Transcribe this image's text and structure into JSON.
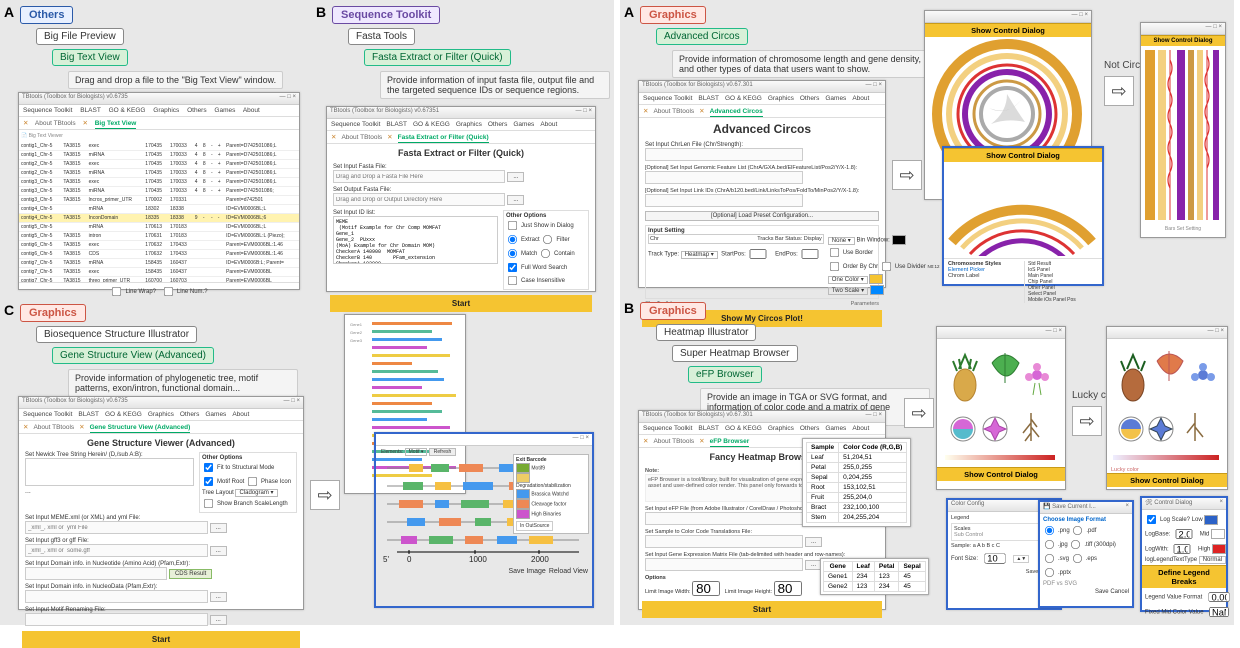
{
  "left": {
    "A": {
      "label": "A",
      "cat": "Others",
      "item1": "Big File Preview",
      "item2": "Big Text View",
      "help": "Drag and drop a file to the \"Big Text View\" window.",
      "win_title": "TBtools (Toolbox for Biologists) v0.6735",
      "menus": [
        "Sequence Toolkit",
        "BLAST",
        "GO & KEGG",
        "Graphics",
        "Others",
        "Games",
        "About"
      ],
      "tab1": "About TBtools",
      "tab2": "Big Text View",
      "rows": [
        [
          "contig1_Chr-5",
          "TA3815",
          "exec",
          "170435",
          "170033",
          "4",
          "8",
          "-",
          "+",
          "Parent=D742501086;L"
        ],
        [
          "contig1_Chr-5",
          "TA3815",
          "miRNA",
          "170435",
          "170033",
          "4",
          "8",
          "-",
          "+",
          "Parent=D742501086;L"
        ],
        [
          "contig2_Chr-5",
          "TA3815",
          "exec",
          "170435",
          "170033",
          "4",
          "8",
          "-",
          "+",
          "Parent=D742501086;L"
        ],
        [
          "contig2_Chr-5",
          "TA3815",
          "miRNA",
          "170435",
          "170033",
          "4",
          "8",
          "-",
          "+",
          "Parent=D742501086;L"
        ],
        [
          "contig3_Chr-5",
          "TA3815",
          "exec",
          "170435",
          "170033",
          "4",
          "8",
          "-",
          "+",
          "Parent=D742501086;L"
        ],
        [
          "contig3_Chr-5",
          "TA3815",
          "miRNA",
          "170435",
          "170033",
          "4",
          "8",
          "-",
          "+",
          "Parent=D742501086;"
        ],
        [
          "contig3_Chr-5",
          "TA3815",
          "lncros_primer_UTR",
          "170002",
          "170331",
          "",
          "",
          "",
          "",
          "Parent=d742501"
        ],
        [
          "contig4_Chr-5",
          "",
          "mRNA",
          "18302",
          "18338",
          "",
          "",
          "",
          "",
          "ID=EVM0006BL;L"
        ],
        [
          "contig4_Chr-5",
          "TA3815",
          "InconDomain",
          "18335",
          "18338",
          "9",
          "-",
          "-",
          "-",
          "ID=EVM0006BL;6"
        ],
        [
          "contig5_Chr-5",
          "",
          "mRNA",
          "170613",
          "170183",
          "",
          "",
          "",
          "",
          "ID=EVM0006BL;L"
        ],
        [
          "contig5_Chr-5",
          "TA3815",
          "intron",
          "170631",
          "170183",
          "",
          "",
          "",
          "",
          "ID=EVM0006BL:L (Piezo);"
        ],
        [
          "contig6_Chr-5",
          "TA3815",
          "exec",
          "170632",
          "170433",
          "",
          "",
          "",
          "",
          "Parent=EVM0006BL:1.46"
        ],
        [
          "contig6_Chr-5",
          "TA3815",
          "CDS",
          "170632",
          "170433",
          "",
          "",
          "",
          "",
          "Parent=EVM0006BL:1.46"
        ],
        [
          "contig7_Chr-5",
          "TA3815",
          "mRNA",
          "158435",
          "160437",
          "",
          "",
          "",
          "",
          "ID=EVM0006B:L; Parent="
        ],
        [
          "contig7_Chr-5",
          "TA3815",
          "exec",
          "158435",
          "160437",
          "",
          "",
          "",
          "",
          "Parent=EVM0006BL"
        ],
        [
          "contig7_Chr-5",
          "TA3815",
          "threo_primer_UTR",
          "160700",
          "160703",
          "",
          "",
          "",
          "",
          "Parent=EVM0006BL"
        ]
      ],
      "linewrap": "Line Wrap?",
      "linenum": "Line Num.?"
    },
    "B": {
      "label": "B",
      "cat": "Sequence Toolkit",
      "item1": "Fasta Tools",
      "item2": "Fasta Extract or Filter (Quick)",
      "help": "Provide information of input fasta file, output file and the targeted sequence IDs or sequence regions.",
      "win_title": "TBtools (Toolbox for Biologists) v0.67351",
      "tab3": "Fasta Extract or Filter (Quick)",
      "sect": "Fasta Extract or Filter (Quick)",
      "lbl_in": "Set Input Fasta File:",
      "ph_in": "Drag and Drop a Fasta File Here",
      "lbl_out": "Set Output Fasta File:",
      "ph_out": "Drag and Drop or Output Directory Here",
      "lbl_id": "Set Input ID list:",
      "browse": "...",
      "other_opts": "Other Options",
      "just_show": "Just Show in Dialog",
      "extract": "Extract",
      "filter": "Filter",
      "match": "Match",
      "contain": "Contain",
      "full_word": "Full Word Search",
      "case": "Case Insensitive",
      "start": "Start"
    },
    "C": {
      "label": "C",
      "cat": "Graphics",
      "item1": "Biosequence Structure Illustrator",
      "item2": "Gene Structure View (Advanced)",
      "help": "Provide information of phylogenetic tree, motif patterns, exon/intron, functional domain...",
      "win_title": "TBtools (Toolbox for Biologists) v0.6735",
      "tab3": "Gene Structure View (Advanced)",
      "sect": "Gene Structure Viewer (Advanced)",
      "lbl_newick": "Set Newick Tree String Herein/ (D,/sub A:B):",
      "other_opts": "Other Options",
      "fit_struct": "Fit to Structural Mode",
      "motif_root": "Motif Root",
      "phase_icon": "Phase Icon",
      "tree_layout": "Tree Layout",
      "cladogram": "Cladogram ▾",
      "show_branch": "Show Branch ScaleLength",
      "lbl_meme": "Set Input MEME.xml (or XML) and yml File:",
      "ph_meme": "_xml_, xml or  yml File",
      "lbl_gff": "Set Input gff3 or gff File:",
      "ph_gff": "_xml_, xml or  some.gff",
      "lbl_dom": "Set Input Domain info. in Nucleotide (Amino Acid) (Pfam,Extr):",
      "cds_result": "CDS Result",
      "lbl_dom2": "Set Input Domain info. in NucleoData (Pfam,Extr):",
      "lbl_motif_rename": "Set Input Motif Renaming File:",
      "start": "Start",
      "axis_5": "5'",
      "axis_t0": "0",
      "axis_t1": "1000",
      "axis_t2": "2000",
      "barcode_lbl": "Exit Barcode",
      "barcode_item1": "Motif9",
      "barcode_item2": "Degradation/stabilization",
      "barcode_item3": "Brassica Watchd",
      "barcode_item4": "Cleavage factor",
      "barcode_item5": "High Binaries",
      "save": "Save Image",
      "reload": "Reload View",
      "out_dlg_cap": "In OutSource"
    }
  },
  "right": {
    "A": {
      "label": "A",
      "cat": "Graphics",
      "item1": "Advanced Circos",
      "help": "Provide information of chromosome length and gene density, and other types of data that users want to show.",
      "win_title": "TBtools (Toolbox for Biologists) v0.67.301",
      "sect": "Advanced Circos",
      "tab": "Advanced Circos",
      "lbl_chr": "Set Input ChrLen File (Chr/Strength):",
      "lbl_feat": "[Optional] Set Input Genomic Feature List (ChrA/GXA.bed/ElFeatureList/Pos2/Y/X-1.8):",
      "lbl_link": "[Optional] Set Input Link IDs (ChrA/b120.bed/Link/LinksToPos/FoldTo/MinPos2/Y/X-1.8):",
      "load_preset": "[Optional] Load Preset Configuration...",
      "input_setting": "Input Setting",
      "track_style": "Track Type:",
      "heatmap": "Heatmap ▾",
      "startpos": "StartPos:",
      "endpos": "EndPos:",
      "none_lbl": "None ▾",
      "bin_win": "Bin Window:",
      "use_border": "Use Border",
      "order_chr": "Order By Chr",
      "use_divider": "Use Divider",
      "one_color": "One Color ▾",
      "two_scale": "Two Scale ▾",
      "showbtn": "Show My Circos Plot!",
      "ctrl_title": "Show Control Dialog",
      "not_circ": "Not Circlize",
      "barbar_title": "Bars Set Setting",
      "track_panel_hdr": "Bars Set Setting",
      "chromosome_styles": "Chromosome Styles",
      "elt_pick": "Element Picker",
      "chrom_lbl": "Chrom Label",
      "pick_list": [
        "Std Result",
        "IoS Panel",
        "Main Panel",
        "Chip Panel",
        "Other Panel",
        "Select Panel",
        "Mobile iOs Panel Pos"
      ]
    },
    "B": {
      "label": "B",
      "cat": "Graphics",
      "item1": "Heatmap Illustrator",
      "item2": "Super Heatmap Browser",
      "item3": "eFP Browser",
      "help": "Provide an image in TGA or SVG format, and information of color code and a matrix of gene expression.",
      "win_title": "TBtools (Toolbox for Biologists) v0.67.301",
      "tab": "eFP Browser",
      "sect": "Fancy Heatmap Browser",
      "note_lbl": "Note:",
      "lbl_in_eFP": "Set Input eFP File (from Adobe Illustrator / CorelDraw / Photoshop / CorelDraw...):",
      "lbl_code": "Set Sample to Color Code Translations File:",
      "lbl_expr": "Set Input Gene Expression Matrix File (tab-delimited with header and row-names):",
      "options": "Options",
      "limit_w": "Limit Image Width:",
      "limit_h": "Limit Image Height:",
      "start": "Start",
      "sample_tbl_hdr": [
        "Sample",
        "Color Code (R,G,B)"
      ],
      "sample_tbl": [
        [
          "Leaf",
          "51,204,51"
        ],
        [
          "Petal",
          "255,0,255"
        ],
        [
          "Sepal",
          "0,204,255"
        ],
        [
          "Root",
          "153,102,51"
        ],
        [
          "Fruit",
          "255,204,0"
        ],
        [
          "Bract",
          "232,100,100"
        ],
        [
          "Stem",
          "204,255,204"
        ]
      ],
      "gene_hdr": [
        "Gene",
        "Leaf",
        "Petal",
        "Sepal"
      ],
      "gene_rows": [
        [
          "Gene1",
          "234",
          "123",
          "45"
        ],
        [
          "Gene2",
          "123",
          "234",
          "45"
        ]
      ],
      "ctrl_title": "Show Control Dialog",
      "lucky": "Lucky color",
      "save_dlg_title": "Save Current I...",
      "choose_fmt": "Choose Image Format",
      "fmt1": ".png",
      "fmt2": ".jpg",
      "fmt3": ".pdf",
      "fmt4": ".tiff (300dpi)",
      "fmt5": ".svg",
      "fmt6": ".eps",
      "fmt7": ".pptx",
      "dpi_lbl": "PDF vs SVG",
      "save": "Save",
      "cancel": "Cancel",
      "ctl_dlg_title": "Control Dialog",
      "log_scale": "Log Scale?",
      "log_base": "LogBase:",
      "log_type": "logLegendTextType",
      "normal": "Normal",
      "define_breaks": "Define Legend Breaks",
      "legend_fmt": "Legend Value Format",
      "fixed_mid": "Fixed Mid Color Value",
      "low_lbl": "Low",
      "mid_lbl": "Mid",
      "high_lbl": "High",
      "samples_ex": "Sample: a A b B c C",
      "font_size_lbl": "Font Size:",
      "legend_hdr": "Legend",
      "scales_hdr": "Scales",
      "sub_ctrl": "Sub Control"
    }
  }
}
